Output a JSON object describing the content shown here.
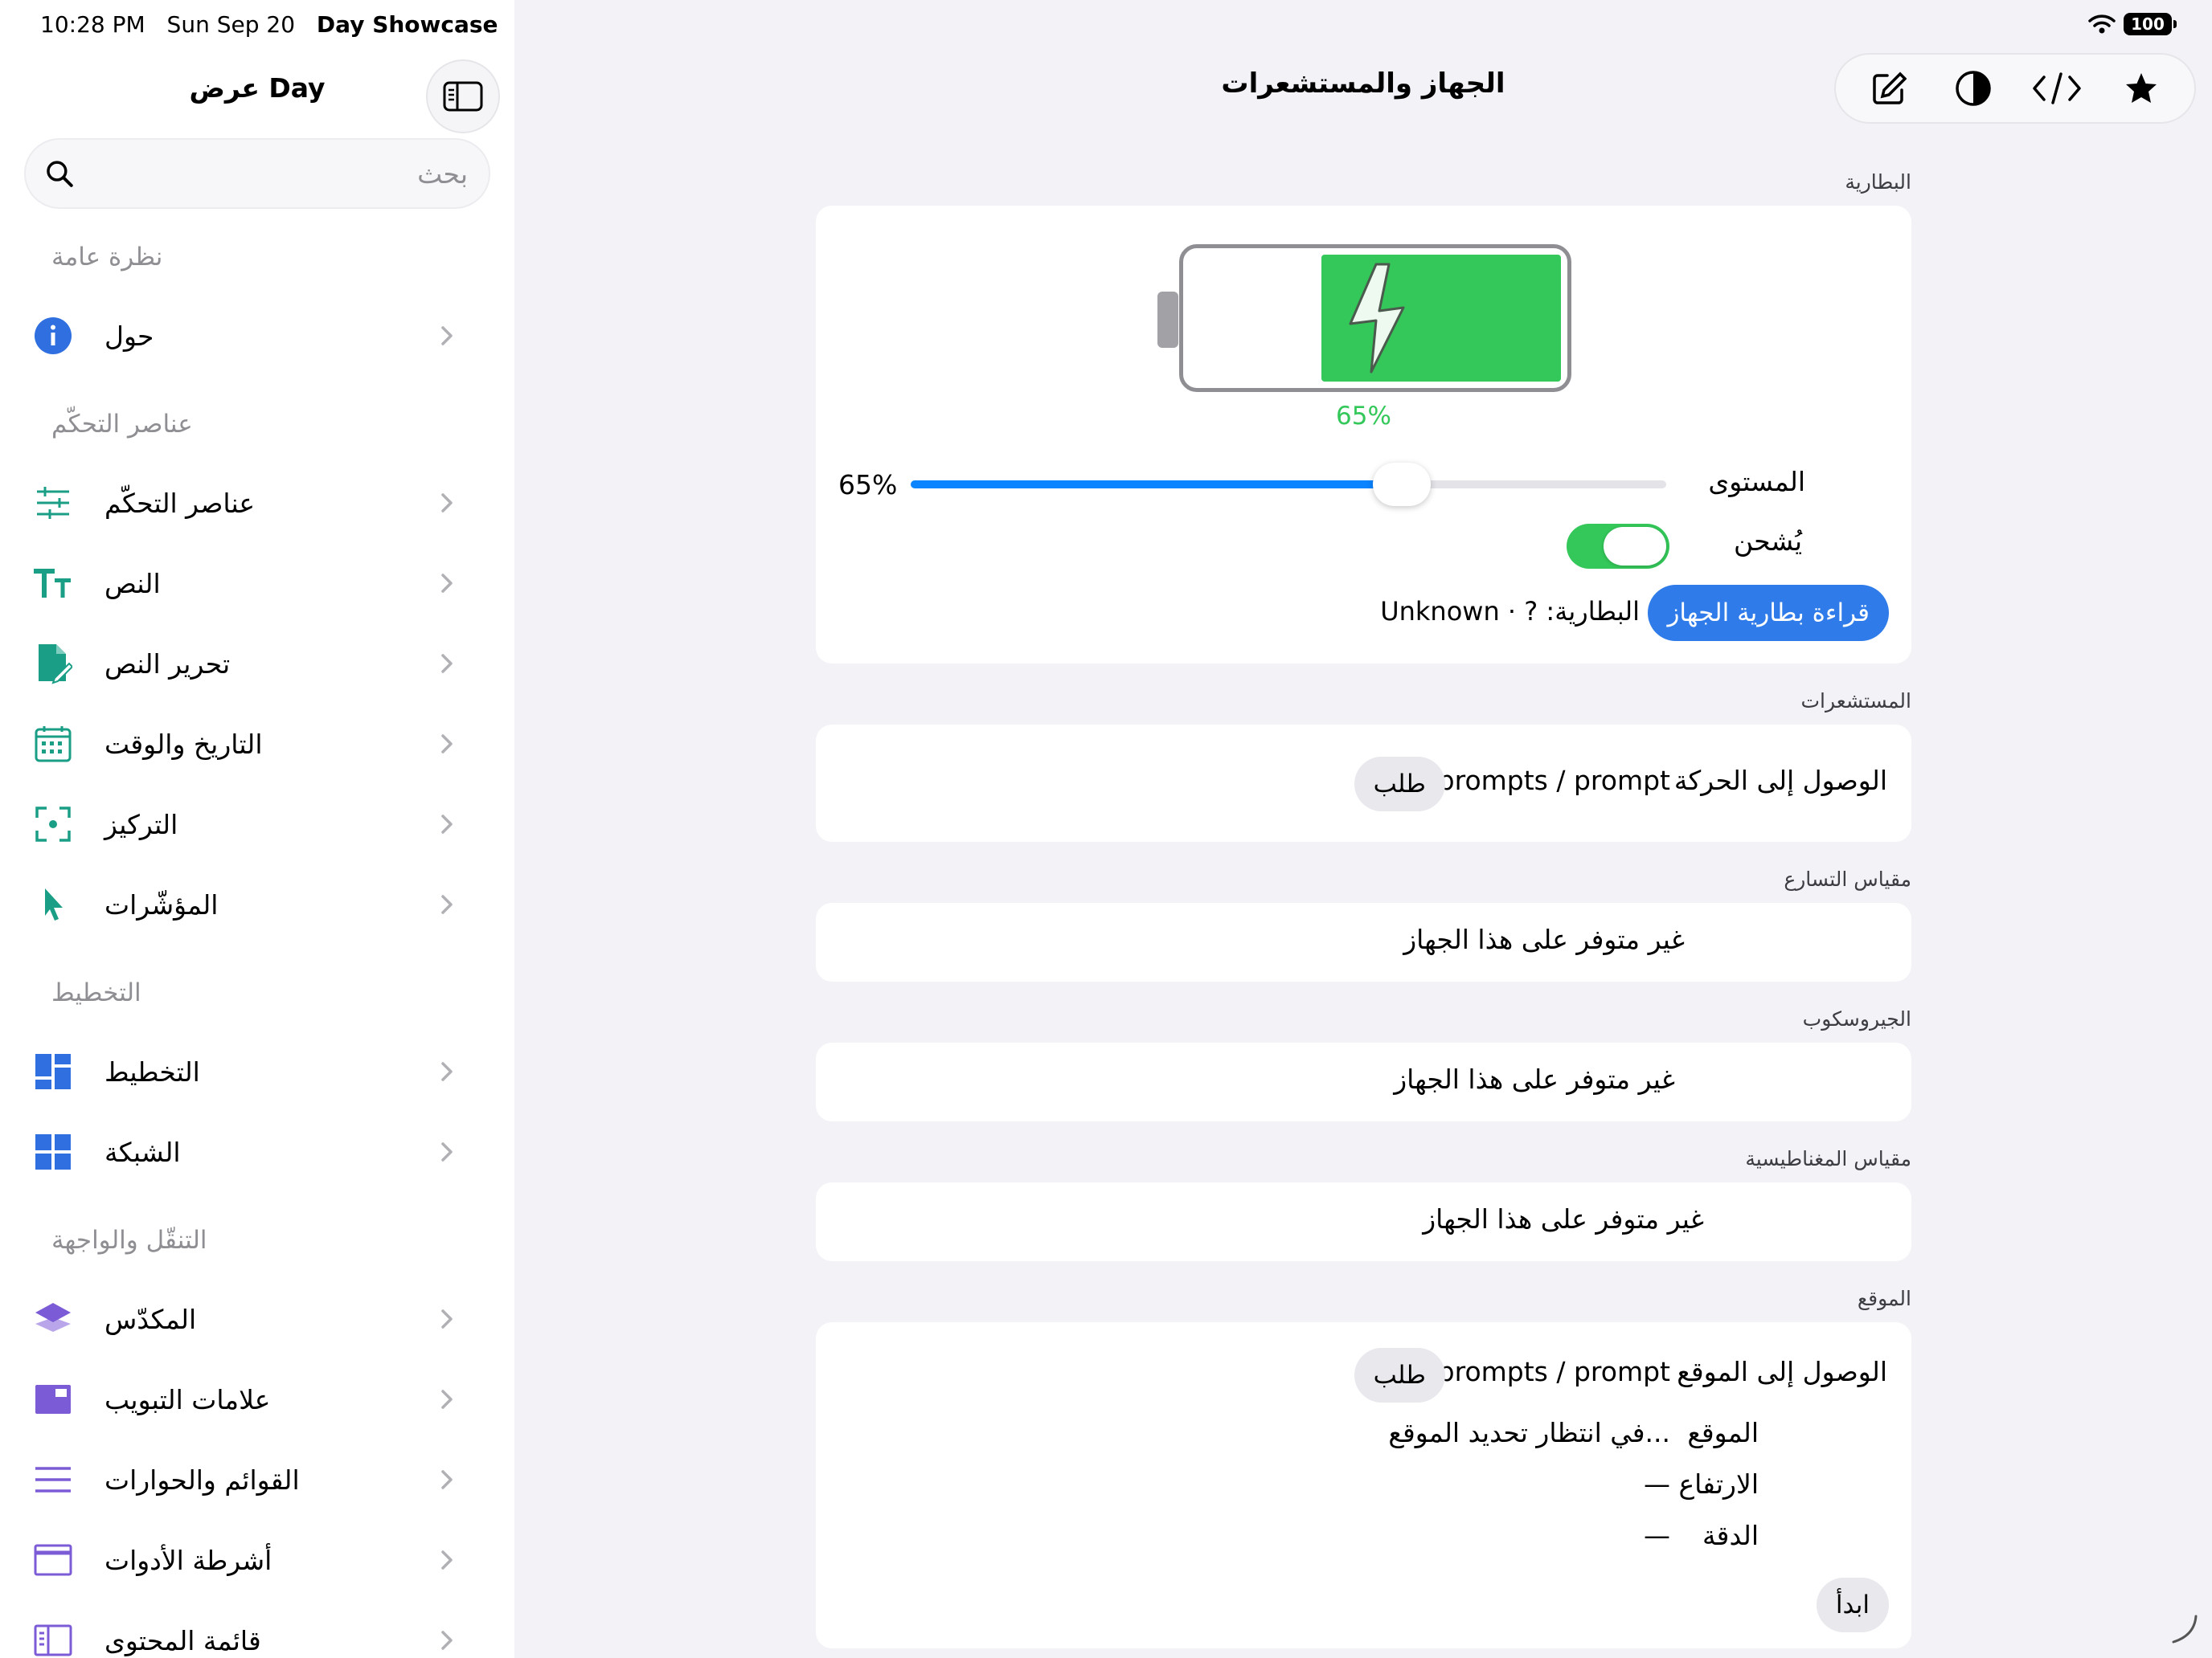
{
  "status_bar": {
    "time": "10:28 PM",
    "date": "Sun Sep 20",
    "app": "Day Showcase",
    "battery": "100"
  },
  "sidebar": {
    "title": "عرض Day",
    "search_placeholder": "بحث",
    "sections": [
      {
        "title": "نظرة عامة",
        "items": [
          {
            "label": "حول",
            "icon": "info-icon"
          }
        ]
      },
      {
        "title": "عناصر التحكّم",
        "items": [
          {
            "label": "عناصر التحكّم",
            "icon": "sliders-icon"
          },
          {
            "label": "النص",
            "icon": "text-size-icon"
          },
          {
            "label": "تحرير النص",
            "icon": "doc-edit-icon"
          },
          {
            "label": "التاريخ والوقت",
            "icon": "calendar-icon"
          },
          {
            "label": "التركيز",
            "icon": "focus-icon"
          },
          {
            "label": "المؤشّرات",
            "icon": "pointer-icon"
          }
        ]
      },
      {
        "title": "التخطيط",
        "items": [
          {
            "label": "التخطيط",
            "icon": "layout-icon"
          },
          {
            "label": "الشبكة",
            "icon": "grid-icon"
          }
        ]
      },
      {
        "title": "التنقّل والواجهة",
        "items": [
          {
            "label": "المكدّس",
            "icon": "stack-icon"
          },
          {
            "label": "علامات التبويب",
            "icon": "tabs-icon"
          },
          {
            "label": "القوائم والحوارات",
            "icon": "menu-lines-icon"
          },
          {
            "label": "أشرطة الأدوات",
            "icon": "toolbar-icon"
          },
          {
            "label": "قائمة المحتوى",
            "icon": "content-list-icon"
          }
        ]
      }
    ]
  },
  "main": {
    "title": "الجهاز والمستشعرات",
    "toolbar": [
      "compose-icon",
      "contrast-icon",
      "code-icon",
      "star-icon"
    ],
    "battery": {
      "caption": "البطارية",
      "level_percent": 65,
      "percent_label": "65%",
      "level_label": "المستوى",
      "level_value": "65%",
      "charging_label": "يُشحن",
      "charging_on": true,
      "read_button": "قراءة بطارية الجهاز",
      "status": "Unknown · ? :البطارية"
    },
    "sensors": {
      "caption": "المستشعرات",
      "label": "الوصول إلى الحركة",
      "value": "prompts / prompt",
      "button": "طلب"
    },
    "accelerometer": {
      "caption": "مقياس التسارع",
      "text": "غير متوفر على هذا الجهاز"
    },
    "gyroscope": {
      "caption": "الجيروسكوب",
      "text": "غير متوفر على هذا الجهاز"
    },
    "magnetometer": {
      "caption": "مقياس المغناطيسية",
      "text": "غير متوفر على هذا الجهاز"
    },
    "location": {
      "caption": "الموقع",
      "access_label": "الوصول إلى الموقع",
      "access_value": "prompts / prompt",
      "access_button": "طلب",
      "location_label": "الموقع",
      "location_value": "...في انتظار تحديد الموقع",
      "altitude_label": "الارتفاع",
      "altitude_value": "—",
      "accuracy_label": "الدقة",
      "accuracy_value": "—",
      "start_button": "ابدأ"
    }
  },
  "colors": {
    "accent_blue": "#2f7bea",
    "green": "#34c759",
    "teal_icon": "#1a9e86",
    "blue_icon": "#2f6fe0",
    "purple_icon": "#7b5bd6"
  }
}
